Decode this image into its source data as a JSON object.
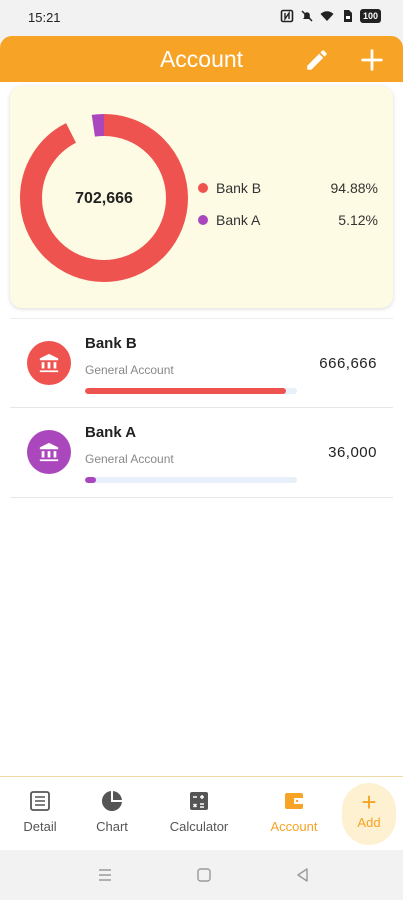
{
  "status_bar": {
    "time": "15:21",
    "battery": "100"
  },
  "header": {
    "title": "Account",
    "edit_icon": "pencil-icon",
    "add_icon": "plus-icon",
    "color": "#f7a325"
  },
  "summary": {
    "total": "702,666",
    "legend": [
      {
        "name": "Bank B",
        "percent": "94.88%",
        "color": "#ef5350",
        "fraction": 0.9488
      },
      {
        "name": "Bank A",
        "percent": "5.12%",
        "color": "#ab47bc",
        "fraction": 0.0512
      }
    ]
  },
  "accounts": [
    {
      "name": "Bank B",
      "type": "General Account",
      "amount": "666,666",
      "color": "#ef5350",
      "icon": "bank-icon",
      "progress": 0.9488
    },
    {
      "name": "Bank A",
      "type": "General Account",
      "amount": "36,000",
      "color": "#ab47bc",
      "icon": "bank-icon",
      "progress": 0.0512
    }
  ],
  "bottom_nav": {
    "items": [
      {
        "label": "Detail",
        "icon": "list-icon"
      },
      {
        "label": "Chart",
        "icon": "pie-chart-icon"
      },
      {
        "label": "Calculator",
        "icon": "calculator-icon"
      },
      {
        "label": "Account",
        "icon": "wallet-icon",
        "active": true
      }
    ],
    "add_label": "Add"
  }
}
